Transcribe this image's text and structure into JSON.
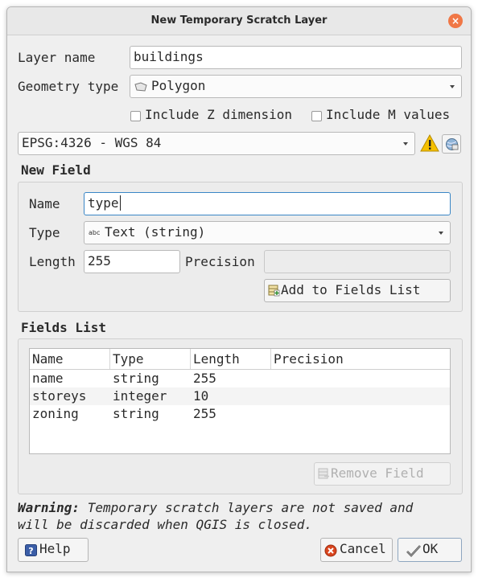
{
  "window": {
    "title": "New Temporary Scratch Layer",
    "close_glyph": "×"
  },
  "layer": {
    "name_label": "Layer name",
    "name_value": "buildings",
    "geometry_label": "Geometry type",
    "geometry_value": "Polygon",
    "include_z_label": "Include Z dimension",
    "include_z_checked": false,
    "include_m_label": "Include M values",
    "include_m_checked": false,
    "crs_value": "EPSG:4326 - WGS 84"
  },
  "new_field": {
    "title": "New Field",
    "name_label": "Name",
    "name_value": "type",
    "type_label": "Type",
    "type_icon_text": "abc",
    "type_value": "Text (string)",
    "length_label": "Length",
    "length_value": "255",
    "precision_label": "Precision",
    "precision_value": "",
    "add_button": "Add to Fields List"
  },
  "fields_list": {
    "title": "Fields List",
    "columns": [
      "Name",
      "Type",
      "Length",
      "Precision"
    ],
    "rows": [
      [
        "name",
        "string",
        "255",
        ""
      ],
      [
        "storeys",
        "integer",
        "10",
        ""
      ],
      [
        "zoning",
        "string",
        "255",
        ""
      ]
    ],
    "remove_button": "Remove Field"
  },
  "warning": {
    "bold": "Warning:",
    "line1": " Temporary scratch layers are not saved and",
    "line2": "will be discarded when QGIS is closed."
  },
  "buttons": {
    "help": "Help",
    "cancel": "Cancel",
    "ok": "OK"
  },
  "colors": {
    "accent": "#f07746",
    "focus": "#3a86c6",
    "warning": "#f5c000"
  }
}
